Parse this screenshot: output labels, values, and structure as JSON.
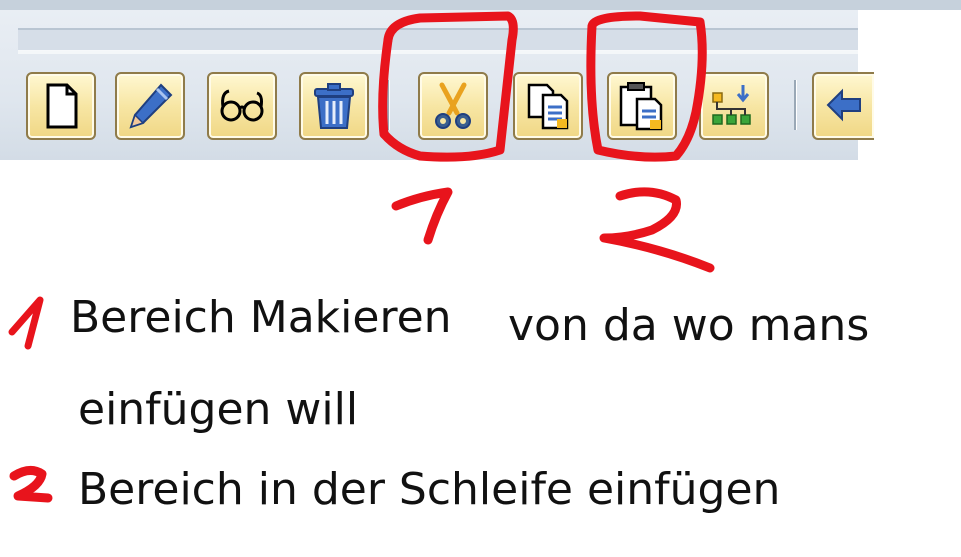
{
  "toolbar": {
    "buttons": [
      {
        "name": "new-document-button",
        "icon": "blank-page-icon"
      },
      {
        "name": "edit-button",
        "icon": "pencil-icon"
      },
      {
        "name": "display-button",
        "icon": "glasses-icon"
      },
      {
        "name": "delete-button",
        "icon": "trash-icon"
      },
      {
        "name": "cut-button",
        "icon": "scissors-icon"
      },
      {
        "name": "copy-button",
        "icon": "copy-icon"
      },
      {
        "name": "paste-button",
        "icon": "paste-icon"
      },
      {
        "name": "insert-block-button",
        "icon": "insert-tree-icon"
      },
      {
        "name": "undo-button",
        "icon": "undo-arrow-icon"
      }
    ]
  },
  "annotations": {
    "marker1": "1",
    "marker2": "2",
    "line1_part_a": "Bereich Makieren",
    "line1_part_b": "von da wo mans",
    "line2": "einfügen will",
    "line3": "Bereich in der Schleife einfügen",
    "ink_color": "#e8141c"
  }
}
